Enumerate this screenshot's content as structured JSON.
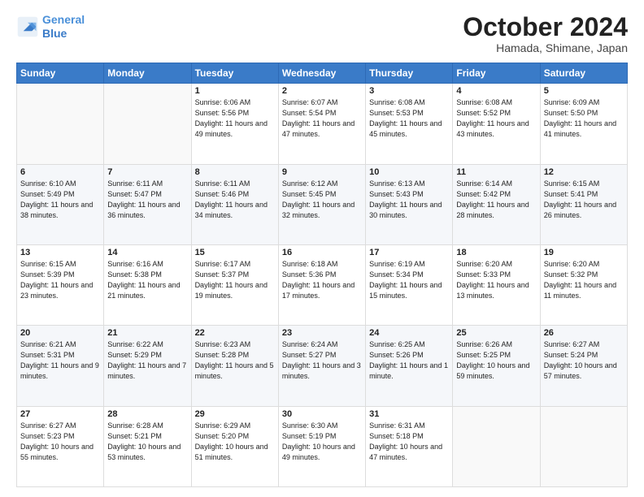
{
  "header": {
    "logo_line1": "General",
    "logo_line2": "Blue",
    "month": "October 2024",
    "location": "Hamada, Shimane, Japan"
  },
  "weekdays": [
    "Sunday",
    "Monday",
    "Tuesday",
    "Wednesday",
    "Thursday",
    "Friday",
    "Saturday"
  ],
  "weeks": [
    [
      {
        "day": "",
        "info": ""
      },
      {
        "day": "",
        "info": ""
      },
      {
        "day": "1",
        "info": "Sunrise: 6:06 AM\nSunset: 5:56 PM\nDaylight: 11 hours and 49 minutes."
      },
      {
        "day": "2",
        "info": "Sunrise: 6:07 AM\nSunset: 5:54 PM\nDaylight: 11 hours and 47 minutes."
      },
      {
        "day": "3",
        "info": "Sunrise: 6:08 AM\nSunset: 5:53 PM\nDaylight: 11 hours and 45 minutes."
      },
      {
        "day": "4",
        "info": "Sunrise: 6:08 AM\nSunset: 5:52 PM\nDaylight: 11 hours and 43 minutes."
      },
      {
        "day": "5",
        "info": "Sunrise: 6:09 AM\nSunset: 5:50 PM\nDaylight: 11 hours and 41 minutes."
      }
    ],
    [
      {
        "day": "6",
        "info": "Sunrise: 6:10 AM\nSunset: 5:49 PM\nDaylight: 11 hours and 38 minutes."
      },
      {
        "day": "7",
        "info": "Sunrise: 6:11 AM\nSunset: 5:47 PM\nDaylight: 11 hours and 36 minutes."
      },
      {
        "day": "8",
        "info": "Sunrise: 6:11 AM\nSunset: 5:46 PM\nDaylight: 11 hours and 34 minutes."
      },
      {
        "day": "9",
        "info": "Sunrise: 6:12 AM\nSunset: 5:45 PM\nDaylight: 11 hours and 32 minutes."
      },
      {
        "day": "10",
        "info": "Sunrise: 6:13 AM\nSunset: 5:43 PM\nDaylight: 11 hours and 30 minutes."
      },
      {
        "day": "11",
        "info": "Sunrise: 6:14 AM\nSunset: 5:42 PM\nDaylight: 11 hours and 28 minutes."
      },
      {
        "day": "12",
        "info": "Sunrise: 6:15 AM\nSunset: 5:41 PM\nDaylight: 11 hours and 26 minutes."
      }
    ],
    [
      {
        "day": "13",
        "info": "Sunrise: 6:15 AM\nSunset: 5:39 PM\nDaylight: 11 hours and 23 minutes."
      },
      {
        "day": "14",
        "info": "Sunrise: 6:16 AM\nSunset: 5:38 PM\nDaylight: 11 hours and 21 minutes."
      },
      {
        "day": "15",
        "info": "Sunrise: 6:17 AM\nSunset: 5:37 PM\nDaylight: 11 hours and 19 minutes."
      },
      {
        "day": "16",
        "info": "Sunrise: 6:18 AM\nSunset: 5:36 PM\nDaylight: 11 hours and 17 minutes."
      },
      {
        "day": "17",
        "info": "Sunrise: 6:19 AM\nSunset: 5:34 PM\nDaylight: 11 hours and 15 minutes."
      },
      {
        "day": "18",
        "info": "Sunrise: 6:20 AM\nSunset: 5:33 PM\nDaylight: 11 hours and 13 minutes."
      },
      {
        "day": "19",
        "info": "Sunrise: 6:20 AM\nSunset: 5:32 PM\nDaylight: 11 hours and 11 minutes."
      }
    ],
    [
      {
        "day": "20",
        "info": "Sunrise: 6:21 AM\nSunset: 5:31 PM\nDaylight: 11 hours and 9 minutes."
      },
      {
        "day": "21",
        "info": "Sunrise: 6:22 AM\nSunset: 5:29 PM\nDaylight: 11 hours and 7 minutes."
      },
      {
        "day": "22",
        "info": "Sunrise: 6:23 AM\nSunset: 5:28 PM\nDaylight: 11 hours and 5 minutes."
      },
      {
        "day": "23",
        "info": "Sunrise: 6:24 AM\nSunset: 5:27 PM\nDaylight: 11 hours and 3 minutes."
      },
      {
        "day": "24",
        "info": "Sunrise: 6:25 AM\nSunset: 5:26 PM\nDaylight: 11 hours and 1 minute."
      },
      {
        "day": "25",
        "info": "Sunrise: 6:26 AM\nSunset: 5:25 PM\nDaylight: 10 hours and 59 minutes."
      },
      {
        "day": "26",
        "info": "Sunrise: 6:27 AM\nSunset: 5:24 PM\nDaylight: 10 hours and 57 minutes."
      }
    ],
    [
      {
        "day": "27",
        "info": "Sunrise: 6:27 AM\nSunset: 5:23 PM\nDaylight: 10 hours and 55 minutes."
      },
      {
        "day": "28",
        "info": "Sunrise: 6:28 AM\nSunset: 5:21 PM\nDaylight: 10 hours and 53 minutes."
      },
      {
        "day": "29",
        "info": "Sunrise: 6:29 AM\nSunset: 5:20 PM\nDaylight: 10 hours and 51 minutes."
      },
      {
        "day": "30",
        "info": "Sunrise: 6:30 AM\nSunset: 5:19 PM\nDaylight: 10 hours and 49 minutes."
      },
      {
        "day": "31",
        "info": "Sunrise: 6:31 AM\nSunset: 5:18 PM\nDaylight: 10 hours and 47 minutes."
      },
      {
        "day": "",
        "info": ""
      },
      {
        "day": "",
        "info": ""
      }
    ]
  ]
}
